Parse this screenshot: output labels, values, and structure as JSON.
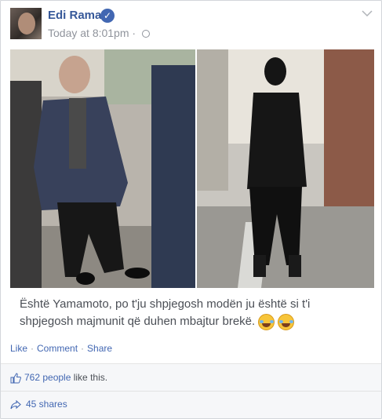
{
  "post": {
    "author": "Edi Rama",
    "timestamp": "Today at 8:01pm",
    "meta_separator": "·",
    "caption": "Është Yamamoto, po t'ju shpjegosh modën ju është si t'i shpjegosh majmunit që duhen mbajtur brekë."
  },
  "actions": {
    "like": "Like",
    "comment": "Comment",
    "share": "Share",
    "separator": "·"
  },
  "footer": {
    "likes_count": "762 people",
    "likes_suffix": " like this.",
    "shares": "45 shares"
  },
  "colors": {
    "link_blue": "#4267b2",
    "name_blue": "#365899",
    "muted_gray": "#90949c"
  },
  "icons": [
    "verified-badge",
    "globe-icon",
    "chevron-down-icon",
    "thumbs-up-icon",
    "share-arrow-icon",
    "tears-of-joy-emoji"
  ]
}
